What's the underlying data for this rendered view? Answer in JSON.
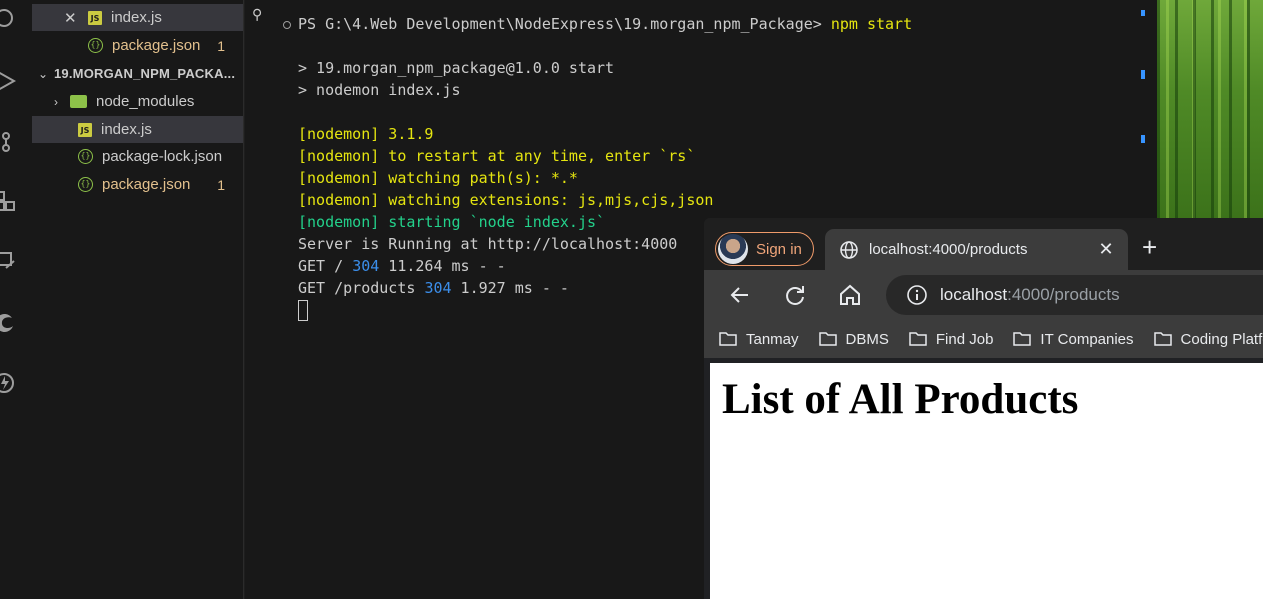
{
  "explorer": {
    "open_editors": [
      {
        "name": "index.js",
        "type": "js"
      },
      {
        "name": "package.json",
        "type": "json",
        "badge": "1"
      }
    ],
    "folder_title": "19.MORGAN_NPM_PACKA...",
    "items": [
      {
        "name": "node_modules",
        "type": "folder"
      },
      {
        "name": "index.js",
        "type": "js"
      },
      {
        "name": "package-lock.json",
        "type": "json"
      },
      {
        "name": "package.json",
        "type": "json",
        "badge": "1"
      }
    ]
  },
  "terminal": {
    "prompt": "PS G:\\4.Web Development\\NodeExpress\\19.morgan_npm_Package> ",
    "command": "npm start",
    "lines": {
      "run1": "> 19.morgan_npm_package@1.0.0 start",
      "run2": "> nodemon index.js",
      "nm_version": "[nodemon] 3.1.9",
      "nm_restart": "[nodemon] to restart at any time, enter `rs`",
      "nm_watch_path": "[nodemon] watching path(s): *.*",
      "nm_watch_ext": "[nodemon] watching extensions: js,mjs,cjs,json",
      "nm_starting": "[nodemon] starting `node index.js`",
      "server": "Server is Running at http://localhost:4000",
      "get1_a": "GET / ",
      "get1_status": "304",
      "get1_b": " 11.264 ms - -",
      "get2_a": "GET /products ",
      "get2_status": "304",
      "get2_b": " 1.927 ms - -"
    }
  },
  "browser": {
    "profile_label": "Sign in",
    "tab_title": "localhost:4000/products",
    "url_host": "localhost",
    "url_path": ":4000/products",
    "bookmarks": [
      "Tanmay",
      "DBMS",
      "Find Job",
      "IT Companies",
      "Coding Platfo"
    ],
    "page_heading": "List of All Products"
  }
}
